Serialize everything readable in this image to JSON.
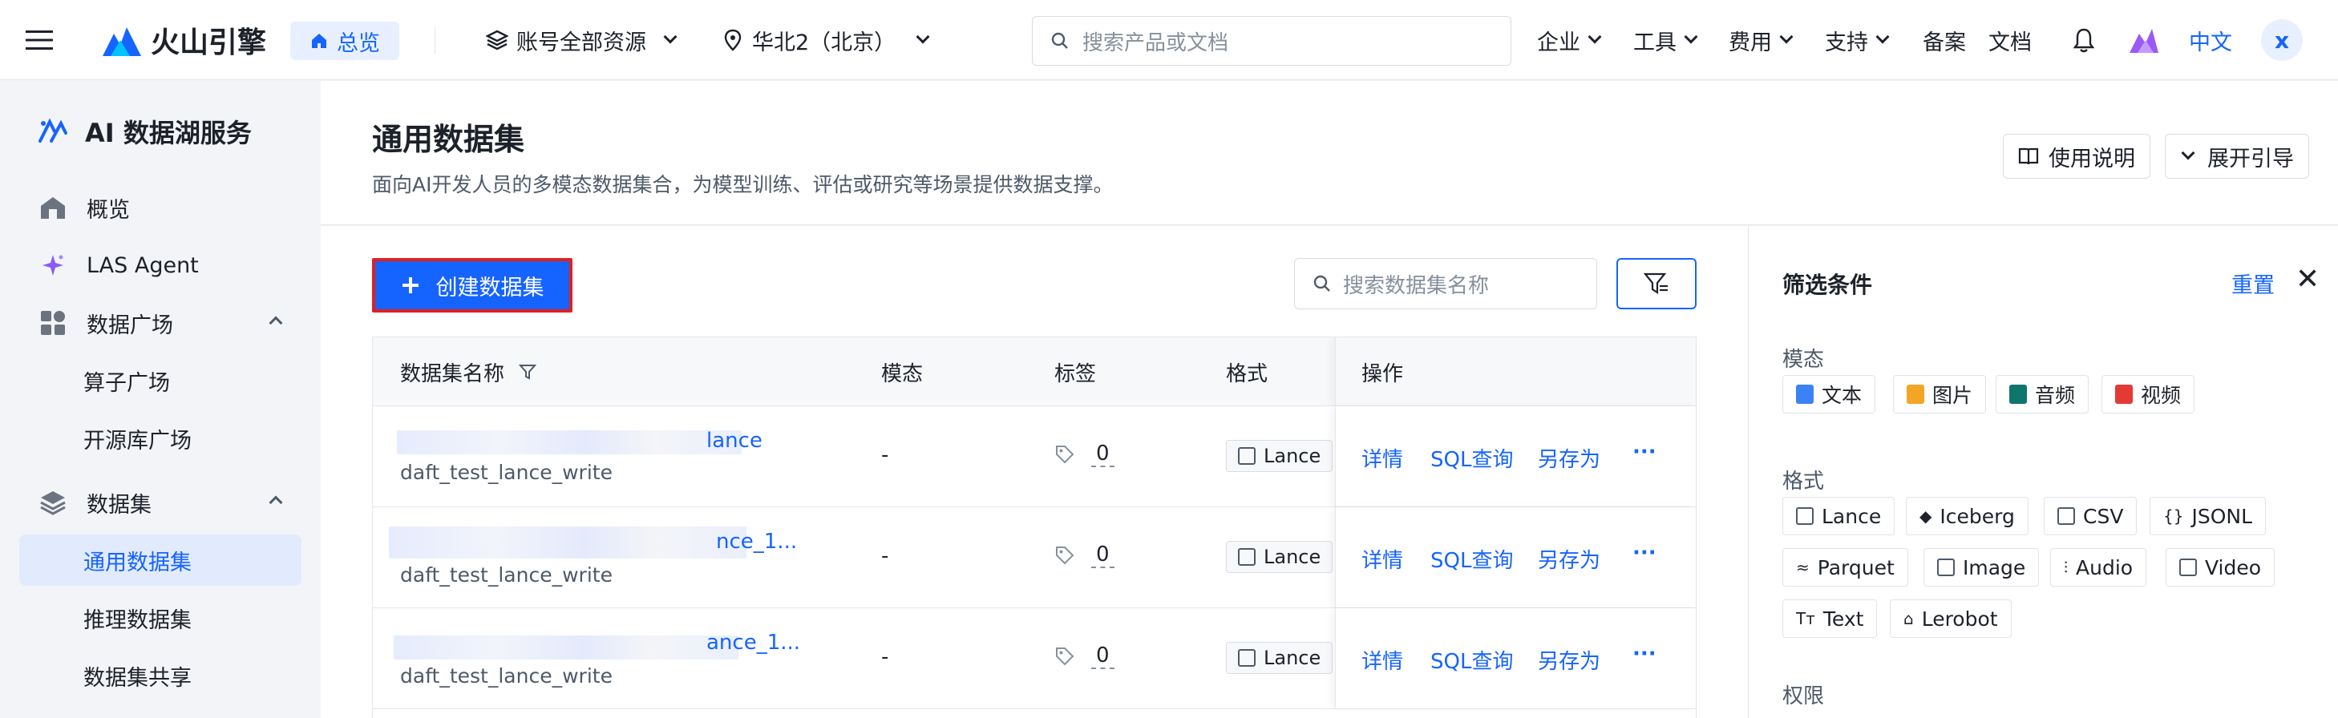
{
  "topnav": {
    "brand": "火山引擎",
    "home": "总览",
    "account": "账号全部资源",
    "region": "华北2（北京）",
    "search_placeholder": "搜索产品或文档",
    "menus": [
      "企业",
      "工具",
      "费用",
      "支持"
    ],
    "links": [
      "备案",
      "文档"
    ],
    "lang": "中文",
    "avatar": "x"
  },
  "sidebar": {
    "title": "AI 数据湖服务",
    "items": [
      {
        "label": "概览",
        "icon": "building-icon"
      },
      {
        "label": "LAS Agent",
        "icon": "sparkle-icon"
      },
      {
        "label": "数据广场",
        "icon": "apps-icon"
      },
      {
        "label": "算子广场"
      },
      {
        "label": "开源库广场"
      },
      {
        "label": "数据集",
        "icon": "layers-icon"
      },
      {
        "label": "通用数据集",
        "active": true
      },
      {
        "label": "推理数据集"
      },
      {
        "label": "数据集共享"
      }
    ]
  },
  "header": {
    "title": "通用数据集",
    "subtitle": "面向AI开发人员的多模态数据集合，为模型训练、评估或研究等场景提供数据支撑。",
    "help": "使用说明",
    "guide": "展开引导"
  },
  "toolbar": {
    "create": "创建数据集",
    "search_placeholder": "搜索数据集名称"
  },
  "table": {
    "columns": [
      "数据集名称",
      "模态",
      "标签",
      "格式",
      "操作"
    ],
    "rows": [
      {
        "name_tail": "lance",
        "desc": "daft_test_lance_write",
        "modality": "-",
        "tags": "0",
        "format": "Lance"
      },
      {
        "name_tail": "nce_1...",
        "desc": "daft_test_lance_write",
        "modality": "-",
        "tags": "0",
        "format": "Lance"
      },
      {
        "name_tail": "ance_1...",
        "desc": "daft_test_lance_write",
        "modality": "-",
        "tags": "0",
        "format": "Lance"
      }
    ],
    "ops": [
      "详情",
      "SQL查询",
      "另存为",
      "···"
    ]
  },
  "filter": {
    "title": "筛选条件",
    "reset": "重置",
    "close": "✕",
    "modality_label": "模态",
    "modalities": [
      "文本",
      "图片",
      "音频",
      "视频"
    ],
    "format_label": "格式",
    "formats": [
      "Lance",
      "Iceberg",
      "CSV",
      "JSONL",
      "Parquet",
      "Image",
      "Audio",
      "Video",
      "Text",
      "Lerobot"
    ],
    "perm_label": "权限"
  },
  "colors": {
    "accent": "#1664ff",
    "highlight": "#e02020"
  }
}
